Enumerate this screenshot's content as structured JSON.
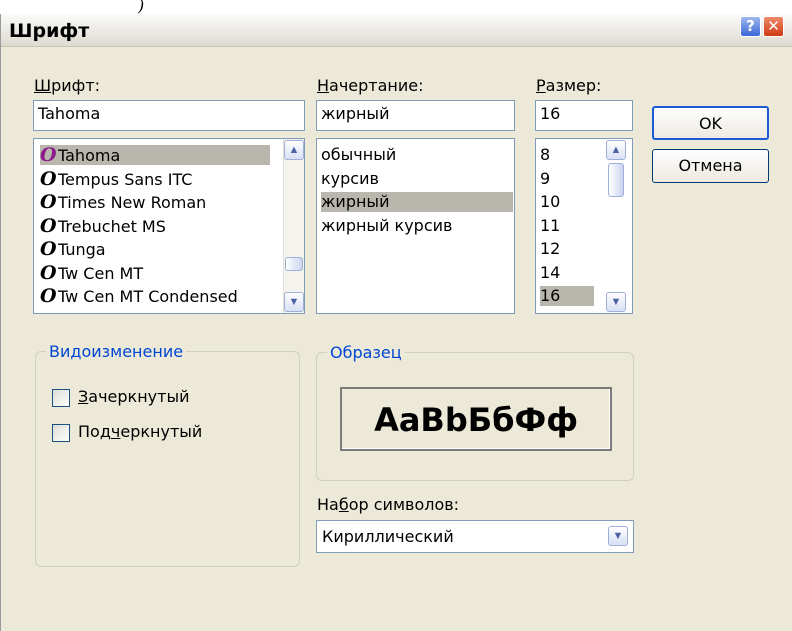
{
  "background_fragment": ")",
  "window": {
    "title": "Шрифт",
    "help_glyph": "?",
    "close_glyph": "✕"
  },
  "font": {
    "label_hotkey": "Ш",
    "label_rest": "рифт:",
    "value": "Tahoma",
    "items": [
      "Tahoma",
      "Tempus Sans ITC",
      "Times New Roman",
      "Trebuchet MS",
      "Tunga",
      "Tw Cen MT",
      "Tw Cen MT Condensed"
    ],
    "selected_index": 0,
    "icon_glyph": "O"
  },
  "style": {
    "label_hotkey": "Н",
    "label_rest": "ачертание:",
    "value": "жирный",
    "items": [
      "обычный",
      "курсив",
      "жирный",
      "жирный курсив"
    ],
    "selected_index": 2
  },
  "size": {
    "label_hotkey": "Р",
    "label_rest": "азмер:",
    "value": "16",
    "items": [
      "8",
      "9",
      "10",
      "11",
      "12",
      "14",
      "16"
    ],
    "selected_index": 6
  },
  "buttons": {
    "ok": "OK",
    "cancel": "Отмена"
  },
  "effects": {
    "title": "Видоизменение",
    "strikeout_hotkey": "З",
    "strikeout_rest": "ачеркнутый",
    "strikeout_checked": false,
    "underline_before": "Под",
    "underline_hotkey": "ч",
    "underline_rest": "еркнутый",
    "underline_checked": false
  },
  "sample": {
    "title": "Образец",
    "text": "AaBbБбФф"
  },
  "charset": {
    "label_before": "На",
    "label_hotkey": "б",
    "label_rest": "ор символов:",
    "value": "Кириллический"
  },
  "colors": {
    "dialog_bg": "#ece9d8",
    "group_title": "#0046d5",
    "font_icon_selected": "#8b1a8b",
    "font_icon": "#000000",
    "list_selection": "#b9b6ad",
    "close_button": "#d64a22",
    "help_button": "#5b82e0"
  }
}
